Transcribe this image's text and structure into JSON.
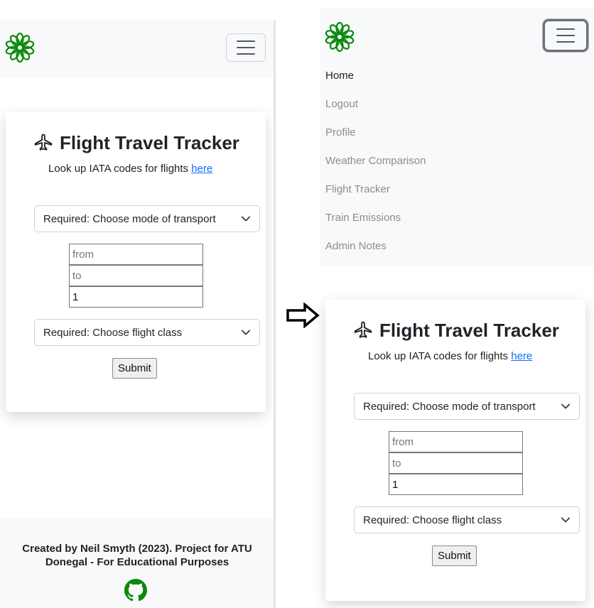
{
  "brand": {
    "logo": "flower-logo-icon",
    "color": "#0a8a0a"
  },
  "nav": {
    "items": [
      {
        "label": "Home",
        "active": true
      },
      {
        "label": "Logout"
      },
      {
        "label": "Profile"
      },
      {
        "label": "Weather Comparison"
      },
      {
        "label": "Flight Tracker"
      },
      {
        "label": "Train Emissions"
      },
      {
        "label": "Admin Notes"
      }
    ]
  },
  "form": {
    "title": "Flight Travel Tracker",
    "title_icon": "airplane-icon",
    "subtitle_prefix": "Look up IATA codes for flights",
    "subtitle_link": "here",
    "transport_select": "Required: Choose mode of transport",
    "from_placeholder": "from",
    "to_placeholder": "to",
    "passengers_value": "1",
    "class_select": "Required: Choose flight class",
    "submit_label": "Submit"
  },
  "footer": {
    "line1": "Created by Neil Smyth (2023). Project for ATU",
    "line2": "Donegal - For Educational Purposes",
    "icon": "github-icon"
  },
  "transition_icon": "right-arrow-icon"
}
